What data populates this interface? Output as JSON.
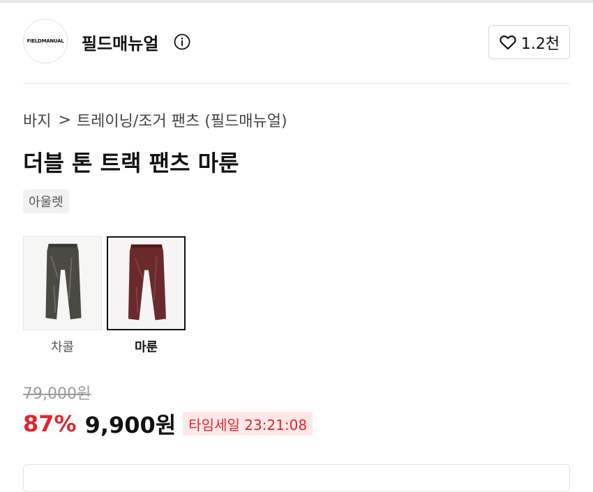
{
  "brand": {
    "logo_text": "FIELDMANUAL",
    "name": "필드매뉴얼",
    "likes": "1.2천"
  },
  "breadcrumb": {
    "category": "바지",
    "separator": ">",
    "subcategory": "트레이닝/조거 팬츠 (필드매뉴얼)"
  },
  "product": {
    "title": "더블 톤 트랙 팬츠 마룬",
    "tag": "아울렛"
  },
  "colors": [
    {
      "label": "차콜",
      "swatch": "#4a4a42",
      "selected": false
    },
    {
      "label": "마룬",
      "swatch": "#6a2a2c",
      "selected": true
    }
  ],
  "pricing": {
    "original": "79,000원",
    "discount": "87%",
    "sale": "9,900원",
    "timesale": "타임세일 23:21:08"
  },
  "theme": {
    "accent_red": "#e0262e",
    "timesale_bg": "#fde8e8"
  }
}
